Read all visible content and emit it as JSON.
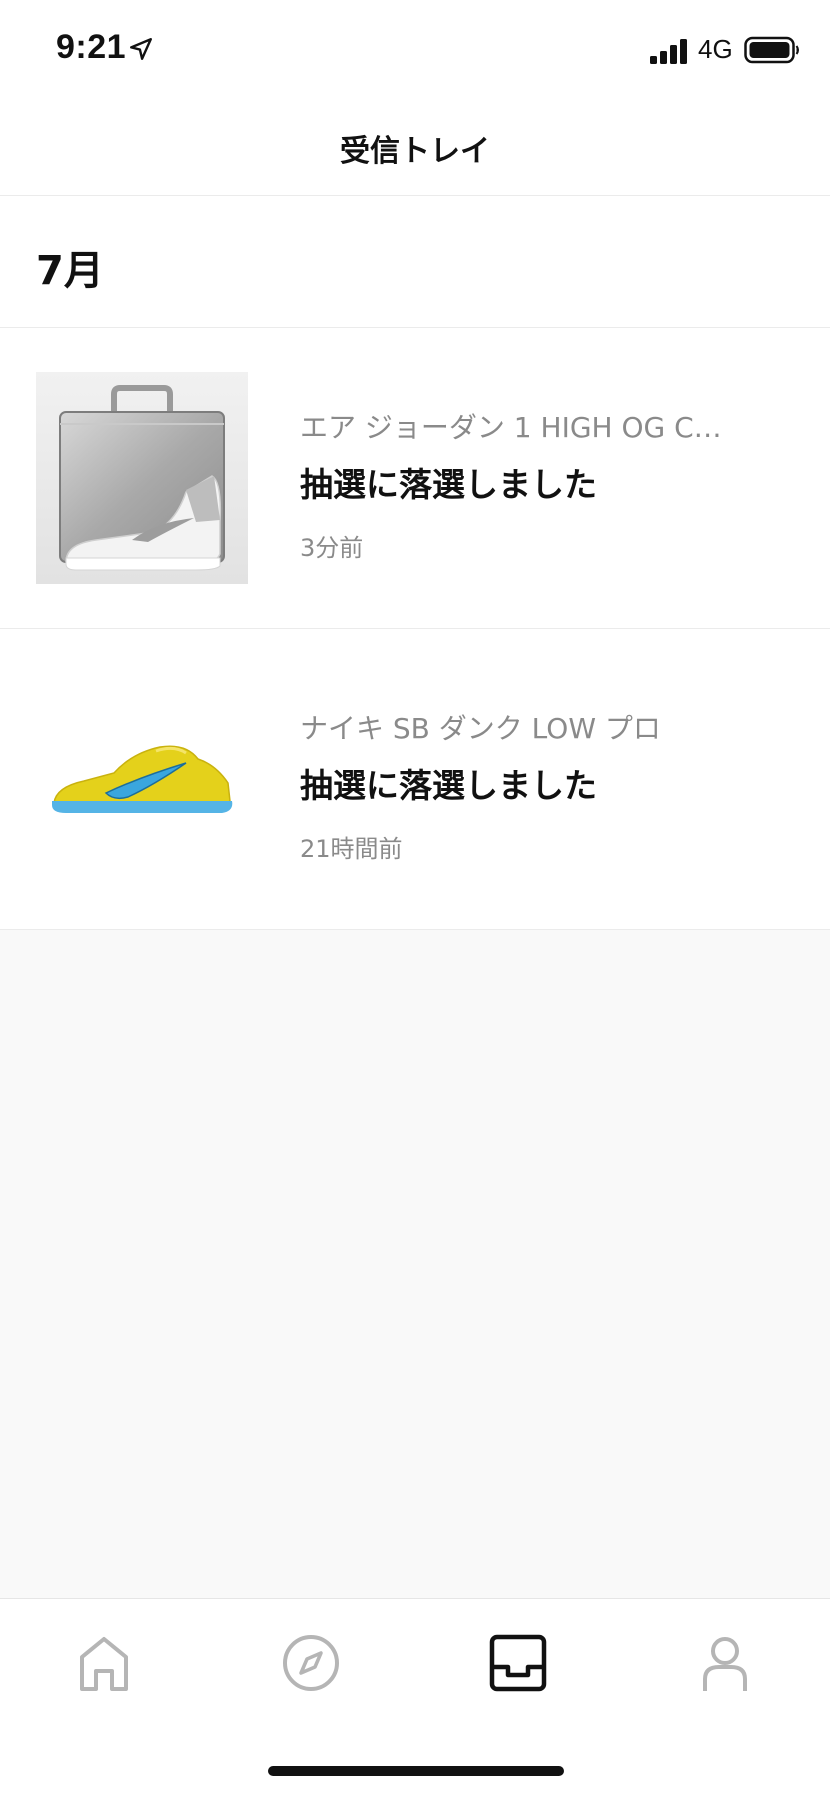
{
  "status_bar": {
    "time": "9:21",
    "network": "4G",
    "icons": [
      "location-arrow-icon",
      "signal-bars-icon",
      "battery-icon"
    ]
  },
  "header": {
    "title": "受信トレイ"
  },
  "section": {
    "month": "7月"
  },
  "notifications": [
    {
      "product": "エア ジョーダン 1 HIGH OG C…",
      "message": "抽選に落選しました",
      "time": "3分前",
      "thumbnail": "silver-sneaker-with-case-image"
    },
    {
      "product": "ナイキ SB ダンク LOW プロ",
      "message": "抽選に落選しました",
      "time": "21時間前",
      "thumbnail": "yellow-sneaker-image"
    }
  ],
  "tabbar": {
    "tabs": [
      {
        "icon": "home-icon",
        "active": false
      },
      {
        "icon": "compass-icon",
        "active": false
      },
      {
        "icon": "inbox-icon",
        "active": true
      },
      {
        "icon": "person-icon",
        "active": false
      }
    ]
  },
  "colors": {
    "background": "#f9f9f9",
    "text_primary": "#111111",
    "text_secondary": "#8a8a8a",
    "tab_inactive": "#b5b5b5",
    "tab_active": "#111111",
    "divider": "#ebebeb"
  }
}
